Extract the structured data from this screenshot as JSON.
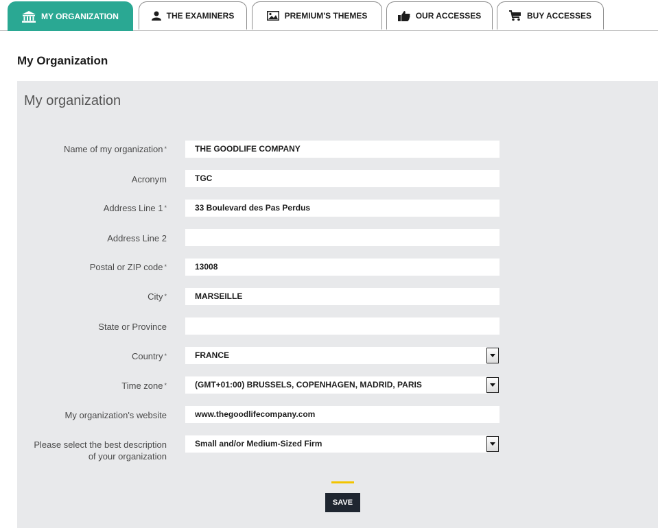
{
  "tabs": [
    {
      "label": "MY ORGANIZATION",
      "icon": "bank-icon",
      "active": true
    },
    {
      "label": "THE EXAMINERS",
      "icon": "user-icon",
      "active": false
    },
    {
      "label": "PREMIUM'S THEMES",
      "icon": "image-icon",
      "active": false
    },
    {
      "label": "OUR ACCESSES",
      "icon": "thumbs-up-icon",
      "active": false
    },
    {
      "label": "BUY ACCESSES",
      "icon": "cart-icon",
      "active": false
    }
  ],
  "page_title": "My Organization",
  "panel_title": "My organization",
  "form": {
    "name": {
      "label": "Name of my organization",
      "required": "*",
      "value": "THE GOODLIFE COMPANY"
    },
    "acronym": {
      "label": "Acronym",
      "value": "TGC"
    },
    "address1": {
      "label": "Address Line 1",
      "required": "*",
      "value": "33 Boulevard des Pas Perdus"
    },
    "address2": {
      "label": "Address Line 2",
      "value": ""
    },
    "postal": {
      "label": "Postal or ZIP code",
      "required": "*",
      "value": "13008"
    },
    "city": {
      "label": "City",
      "required": "*",
      "value": "MARSEILLE"
    },
    "state": {
      "label": "State or Province",
      "value": ""
    },
    "country": {
      "label": "Country",
      "required": "*",
      "value": "FRANCE"
    },
    "timezone": {
      "label": "Time zone",
      "required": "*",
      "value": "(GMT+01:00) BRUSSELS, COPENHAGEN, MADRID, PARIS"
    },
    "website": {
      "label": "My organization's website",
      "value": "www.thegoodlifecompany.com"
    },
    "description": {
      "label_line1": "Please select the best description",
      "label_line2": "of your organization",
      "value": "Small and/or Medium-Sized Firm"
    }
  },
  "save_label": "SAVE",
  "colors": {
    "accent": "#2aa893",
    "panel": "#e8e9eb",
    "save_button": "#1f2630",
    "divider": "#f2c400"
  }
}
